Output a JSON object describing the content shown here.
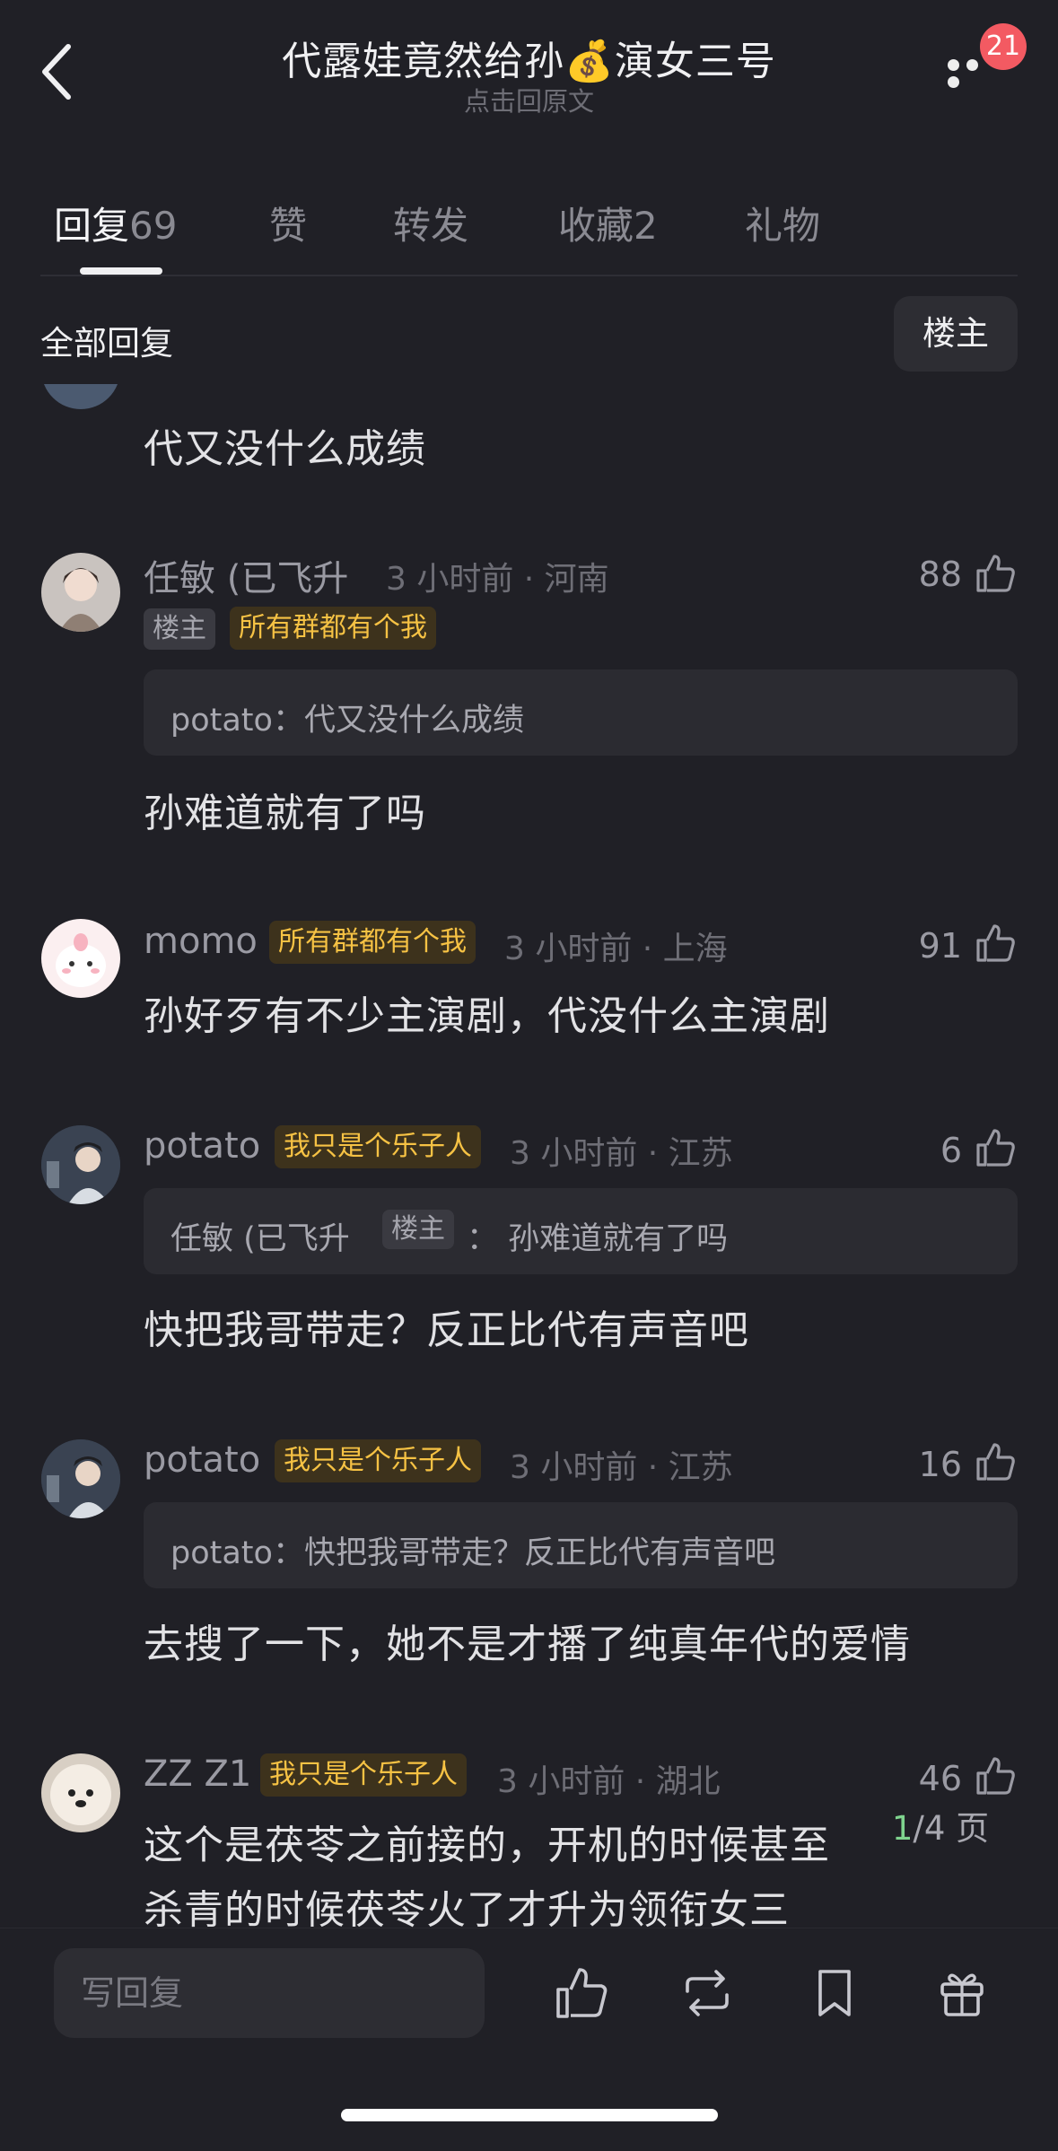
{
  "header": {
    "title": "代露娃竟然给孙💰演女三号",
    "subtitle": "点击回原文",
    "notification_count": "21"
  },
  "tabs": [
    {
      "label": "回复",
      "count": "69"
    },
    {
      "label": "赞",
      "count": ""
    },
    {
      "label": "转发",
      "count": ""
    },
    {
      "label": "收藏",
      "count": "2"
    },
    {
      "label": "礼物",
      "count": ""
    }
  ],
  "filter": {
    "label": "全部回复",
    "button": "楼主"
  },
  "comments": [
    {
      "text": "代又没什么成绩"
    },
    {
      "name": "任敏 (已飞升",
      "time_location": "3 小时前 · 河南",
      "tags": [
        "楼主",
        "所有群都有个我"
      ],
      "quote": "potato：代又没什么成绩",
      "text": "孙难道就有了吗",
      "likes": "88"
    },
    {
      "name": "momo",
      "tag": "所有群都有个我",
      "time_location": "3 小时前 · 上海",
      "text": "孙好歹有不少主演剧，代没什么主演剧",
      "likes": "91"
    },
    {
      "name": "potato",
      "tag": "我只是个乐子人",
      "time_location": "3 小时前 · 江苏",
      "quote_name": "任敏 (已飞升",
      "quote_tag": "楼主",
      "quote_text": "： 孙难道就有了吗",
      "text": "快把我哥带走？反正比代有声音吧",
      "likes": "6"
    },
    {
      "name": "potato",
      "tag": "我只是个乐子人",
      "time_location": "3 小时前 · 江苏",
      "quote": "potato：快把我哥带走？反正比代有声音吧",
      "text": "去搜了一下，她不是才播了纯真年代的爱情",
      "likes": "16"
    },
    {
      "name": "ZZ Z1",
      "tag": "我只是个乐子人",
      "time_location": "3 小时前 · 湖北",
      "text_line1": "这个是茯苓之前接的，开机的时候甚至",
      "text_line2": "杀青的时候茯苓火了才升为领衔女三",
      "likes": "46"
    }
  ],
  "pagination": {
    "current": "1",
    "total": "/4 页"
  },
  "bottom_bar": {
    "reply_placeholder": "写回复"
  },
  "colors": {
    "background": "#202026",
    "accent_tag": "#f6c244",
    "badge": "#f35a62",
    "page_current": "#7fd38e"
  }
}
